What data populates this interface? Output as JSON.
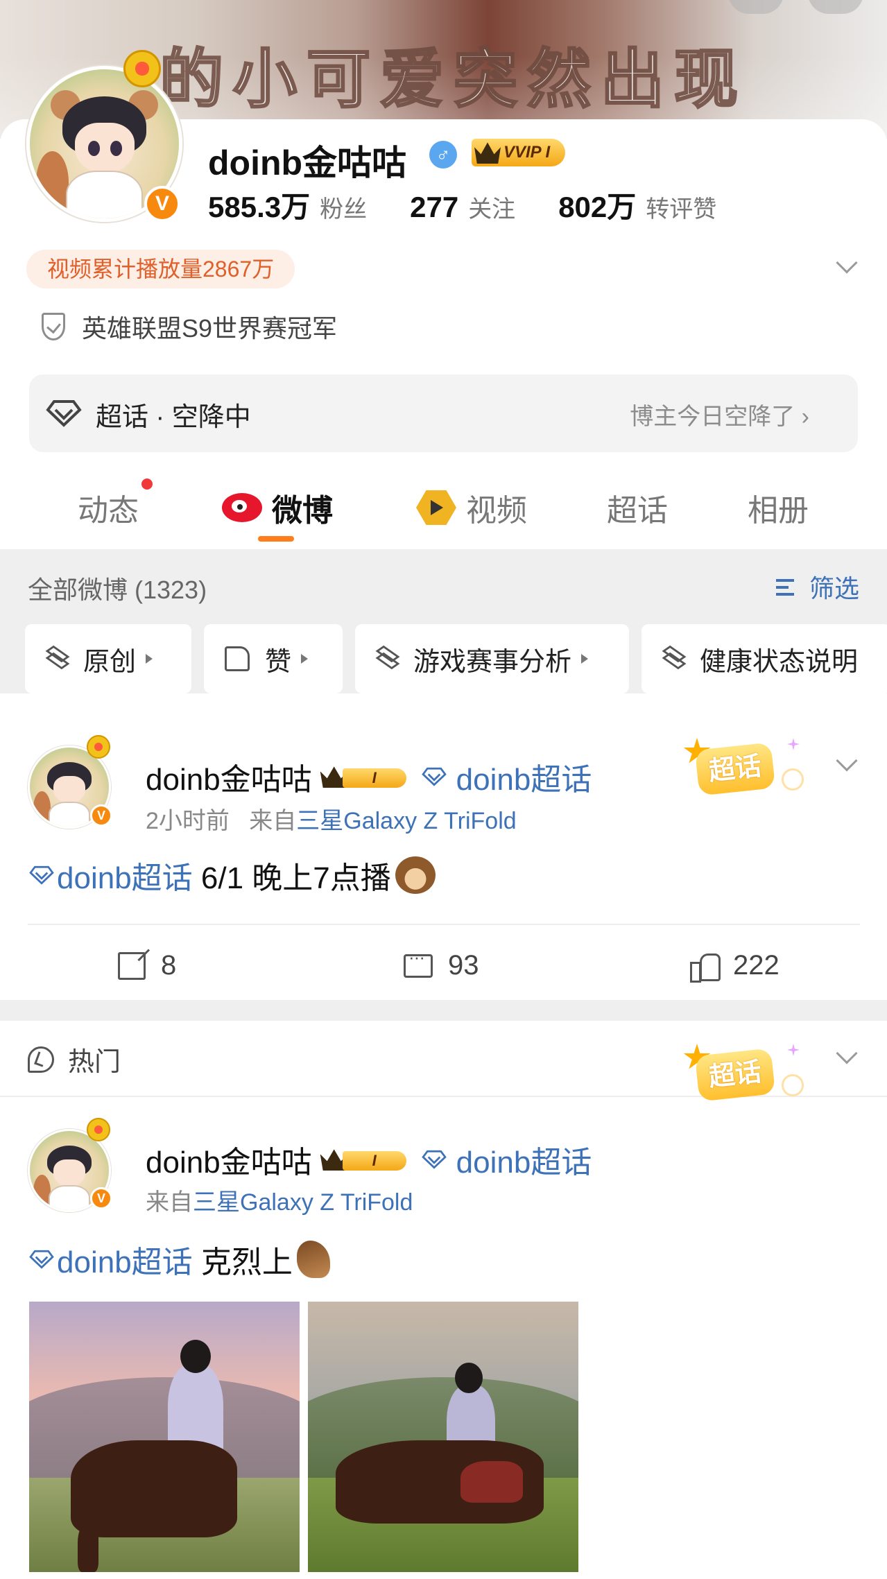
{
  "banner": {
    "text": "的小可爱突然出现"
  },
  "profile": {
    "name": "doinb金咕咕",
    "gender_icon": "male-icon",
    "vip_label": "VVIP I",
    "stats": [
      {
        "value": "585.3万",
        "label": "粉丝"
      },
      {
        "value": "277",
        "label": "关注"
      },
      {
        "value": "802万",
        "label": "转评赞"
      }
    ],
    "play_count": "视频累计播放量2867万",
    "certification": "英雄联盟S9世界赛冠军",
    "supertopic_bar": {
      "label": "超话 · 空降中",
      "right_text": "博主今日空降了 ›"
    }
  },
  "tabs": [
    {
      "label": "动态",
      "has_dot": true
    },
    {
      "label": "微博",
      "active": true
    },
    {
      "label": "视频"
    },
    {
      "label": "超话"
    },
    {
      "label": "相册"
    }
  ],
  "filter": {
    "all_label": "全部微博 (1323)",
    "filter_label": "筛选",
    "chips": [
      "原创",
      "赞",
      "游戏赛事分析",
      "健康状态说明"
    ]
  },
  "posts": [
    {
      "author": "doinb金咕咕",
      "vip_label": "I",
      "topic": "doinb超话",
      "time": "2小时前",
      "source_prefix": "来自",
      "source": "三星Galaxy Z TriFold",
      "body_topic": "doinb超话",
      "body_text": " 6/1 晚上7点播",
      "emoji": "monkey-emoji",
      "supertopic_badge": "超话",
      "shares": "8",
      "comments": "93",
      "likes": "222"
    },
    {
      "section_label": "热门",
      "author": "doinb金咕咕",
      "vip_label": "I",
      "topic": "doinb超话",
      "source_prefix": "来自",
      "source": "三星Galaxy Z TriFold",
      "body_topic": "doinb超话",
      "body_text": " 克烈上",
      "emoji": "horse-emoji",
      "supertopic_badge": "超话"
    }
  ],
  "colors": {
    "accent_orange": "#ff7d1a",
    "link_blue": "#3d71b8",
    "play_pill_text": "#e0602a",
    "verified_orange": "#f78a0e"
  }
}
